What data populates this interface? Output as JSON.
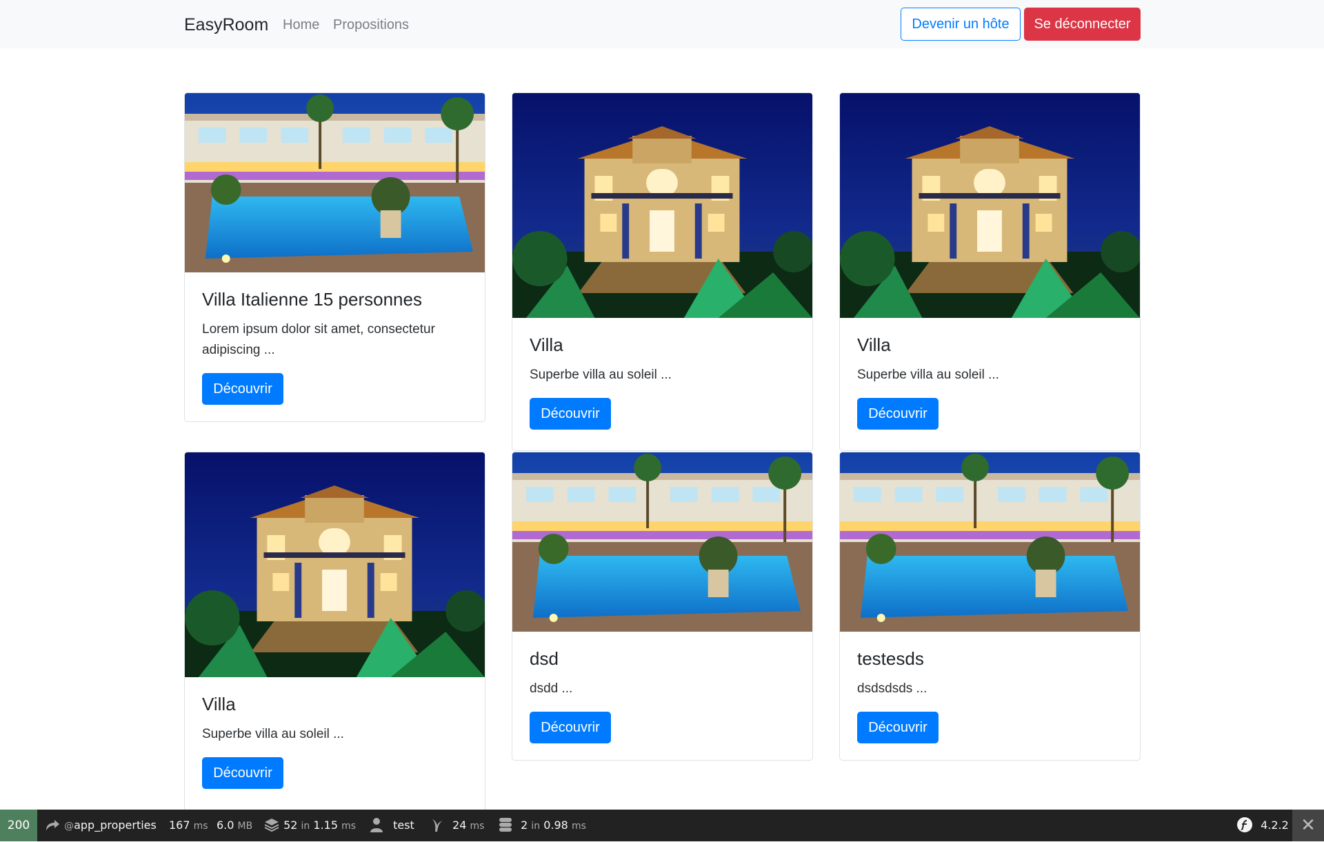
{
  "navbar": {
    "brand": "EasyRoom",
    "links": [
      "Home",
      "Propositions"
    ],
    "host_button": "Devenir un hôte",
    "logout_button": "Se déconnecter"
  },
  "cards": [
    {
      "title": "Villa Italienne 15 personnes",
      "text": "Lorem ipsum dolor sit amet, consectetur adipiscing ...",
      "button": "Découvrir",
      "image": "pool-resort"
    },
    {
      "title": "Villa",
      "text": "Superbe villa au soleil ...",
      "button": "Découvrir",
      "image": "villa-night"
    },
    {
      "title": "Villa",
      "text": "Superbe villa au soleil ...",
      "button": "Découvrir",
      "image": "villa-night"
    },
    {
      "title": "Villa",
      "text": "Superbe villa au soleil ...",
      "button": "Découvrir",
      "image": "villa-night"
    },
    {
      "title": "dsd",
      "text": "dsdd ...",
      "button": "Découvrir",
      "image": "pool-resort"
    },
    {
      "title": "testesds",
      "text": "dsdsdsds ...",
      "button": "Découvrir",
      "image": "pool-resort"
    }
  ],
  "toolbar": {
    "status": "200",
    "route": "app_properties",
    "route_prefix": "@",
    "time": "167",
    "time_unit": "ms",
    "memory": "6.0",
    "memory_unit": "MB",
    "cache_count": "52",
    "cache_in": "in",
    "cache_time": "1.15",
    "cache_unit": "ms",
    "user": "test",
    "twig_time": "24",
    "twig_unit": "ms",
    "db_count": "2",
    "db_in": "in",
    "db_time": "0.98",
    "db_unit": "ms",
    "version": "4.2.2",
    "status_color": "#4f805d"
  },
  "colors": {
    "primary": "#007bff",
    "danger": "#dc3545",
    "navbar_bg": "#f8f9fa"
  }
}
